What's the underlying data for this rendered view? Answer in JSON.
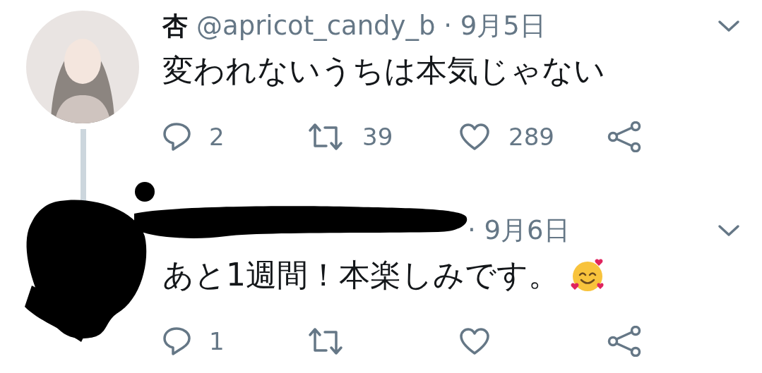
{
  "tweets": [
    {
      "name": "杏",
      "meta": "@apricot_candy_b · 9月5日",
      "text": "変われないうちは本気じゃない",
      "thread_line": true,
      "replies": "2",
      "retweets": "39",
      "likes": "289"
    },
    {
      "meta": "· 9月6日",
      "text": "あと1週間！本楽しみです。",
      "thread_line": false,
      "replies": "1"
    }
  ]
}
